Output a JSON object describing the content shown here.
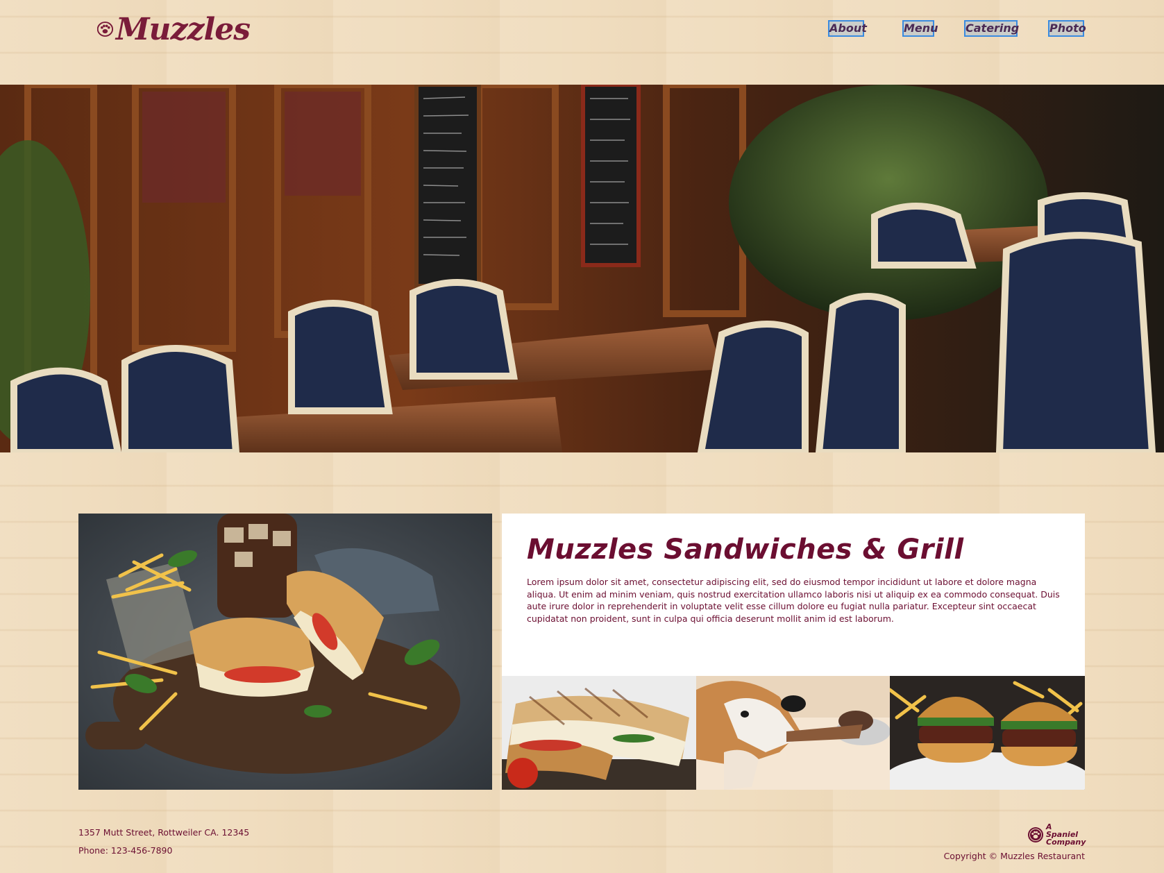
{
  "brand": {
    "name": "Muzzles",
    "color": "#7a1c3a"
  },
  "nav": {
    "items": [
      {
        "label": "About"
      },
      {
        "label": "Menu"
      },
      {
        "label": "Catering"
      },
      {
        "label": "Photo"
      }
    ]
  },
  "hero": {
    "image": "restaurant-patio-photo"
  },
  "main": {
    "title": "Muzzles Sandwiches & Grill",
    "body": "Lorem ipsum dolor sit amet, consectetur adipiscing elit, sed do eiusmod tempor incididunt ut labore et dolore magna aliqua. Ut enim ad minim veniam, quis nostrud exercitation ullamco laboris nisi ut aliquip ex ea commodo consequat. Duis aute irure dolor in reprehenderit in voluptate velit esse cillum dolore eu fugiat nulla pariatur. Excepteur sint occaecat cupidatat non proident, sunt in culpa qui officia deserunt mollit anim id est laborum.",
    "accent": "#6b0e31",
    "feature_image": "sandwich-platter-photo",
    "thumbnails": [
      {
        "image": "panini-photo"
      },
      {
        "image": "beagle-eating-photo"
      },
      {
        "image": "burgers-photo"
      }
    ]
  },
  "footer": {
    "address": "1357 Mutt Street, Rottweiler CA. 12345",
    "phone": "Phone: 123-456-7890",
    "badge": "A Spaniel Company",
    "copyright": "Copyright © Muzzles Restaurant"
  }
}
